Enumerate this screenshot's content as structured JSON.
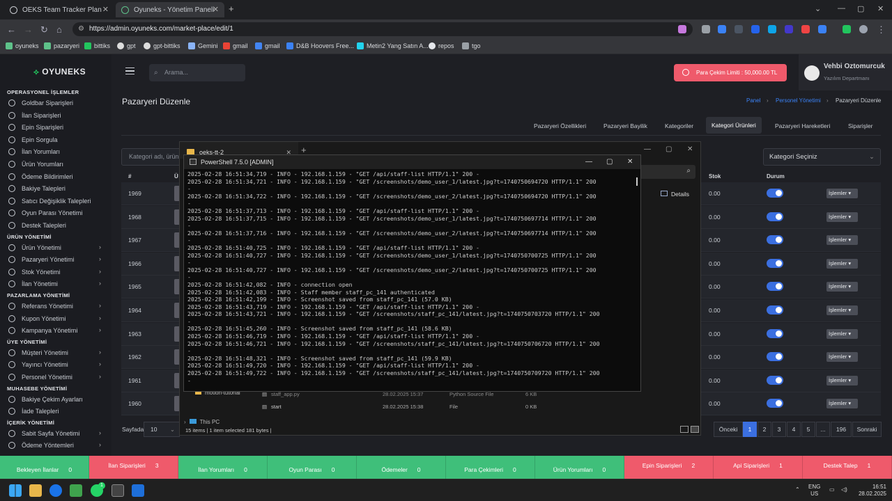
{
  "browser": {
    "tabs": [
      {
        "label": "OEKS Team Tracker Plan"
      },
      {
        "label": "Oyuneks - Yönetim Paneli"
      }
    ],
    "url": "https://admin.oyuneks.com/market-place/edit/1",
    "bookmarks": [
      "oyuneks",
      "pazaryeri",
      "bittiks",
      "gpt",
      "gpt-bittiks",
      "Gemini",
      "gmail",
      "gmail",
      "D&B Hoovers Free...",
      "Metin2 Yang Satın A...",
      "repos",
      "tgo"
    ]
  },
  "brand": "OYUNEKS",
  "sidebar": {
    "sections": [
      {
        "title": "OPERASYONEL İŞLEMLER",
        "items": [
          "Goldbar Siparişleri",
          "İlan Siparişleri",
          "Epin Siparişleri",
          "Epin Sorgula",
          "İlan Yorumları",
          "Ürün Yorumları",
          "Ödeme Bildirimleri",
          "Bakiye Talepleri",
          "Satıcı Değişiklik Talepleri",
          "Oyun Parası Yönetimi",
          "Destek Talepleri"
        ]
      },
      {
        "title": "ÜRÜN YÖNETİMİ",
        "items": [
          "Ürün Yönetimi",
          "Pazaryeri Yönetimi",
          "Stok Yönetimi",
          "İlan Yönetimi"
        ]
      },
      {
        "title": "PAZARLAMA YÖNETİMİ",
        "items": [
          "Referans Yönetimi",
          "Kupon Yönetimi",
          "Kampanya Yönetimi"
        ]
      },
      {
        "title": "ÜYE YÖNETİMİ",
        "items": [
          "Müşteri Yönetimi",
          "Yayıncı Yönetimi",
          "Personel Yönetimi"
        ]
      },
      {
        "title": "MUHASEBE YÖNETİMİ",
        "items": [
          "Bakiye Çekim Ayarları",
          "İade Talepleri"
        ]
      },
      {
        "title": "İÇERİK YÖNETİMİ",
        "items": [
          "Sabit Sayfa Yönetimi",
          "Ödeme Yöntemleri"
        ]
      }
    ]
  },
  "header": {
    "search_placeholder": "Arama...",
    "limit_text": "Para Çekim Limiti : 50,000.00 TL",
    "user_name": "Vehbi Oztomurcuk",
    "user_dept": "Yazılım Departmanı"
  },
  "page": {
    "title": "Pazaryeri Düzenle",
    "breadcrumb": [
      "Panel",
      "Personel Yönetimi",
      "Pazaryeri Düzenle"
    ],
    "tabs": [
      "Pazaryeri Özellikleri",
      "Pazaryeri Bayilik",
      "Kategoriler",
      "Kategori Ürünleri",
      "Pazaryeri Hareketleri",
      "Siparişler"
    ],
    "filter_placeholder": "Kategori adı, ürün",
    "category_select": "Kategori Seçiniz",
    "columns": {
      "id": "#",
      "product": "Ü",
      "stock": "Stok",
      "status": "Durum"
    },
    "rows": [
      {
        "id": "1969",
        "stock": "0.00"
      },
      {
        "id": "1968",
        "stock": "0.00"
      },
      {
        "id": "1967",
        "stock": "0.00"
      },
      {
        "id": "1966",
        "stock": "0.00"
      },
      {
        "id": "1965",
        "stock": "0.00"
      },
      {
        "id": "1964",
        "stock": "0.00"
      },
      {
        "id": "1963",
        "stock": "0.00"
      },
      {
        "id": "1962",
        "stock": "0.00"
      },
      {
        "id": "1961",
        "stock": "0.00"
      },
      {
        "id": "1960",
        "stock": "0.00"
      }
    ],
    "ops_label": "İşlemler",
    "per_page_label": "Sayfada",
    "per_page": "10",
    "pagination": [
      "Önceki",
      "1",
      "2",
      "3",
      "4",
      "5",
      "...",
      "196",
      "Sonraki"
    ]
  },
  "explorer": {
    "tab": "oeks-tt-2",
    "details": "Details",
    "side": [
      "motion-tutorial",
      "This PC"
    ],
    "files": [
      {
        "name": "staff_app.py",
        "date": "28.02.2025 15:37",
        "type": "Python Source File",
        "size": "6 KB"
      },
      {
        "name": "start",
        "date": "28.02.2025 15:38",
        "type": "File",
        "size": "0 KB"
      }
    ],
    "status": "15 items  |  1 item selected  181 bytes  |"
  },
  "powershell": {
    "title": "PowerShell 7.5.0 [ADMIN]",
    "lines": [
      "2025-02-28 16:51:34,719 - INFO - 192.168.1.159 - \"GET /api/staff-list HTTP/1.1\" 200 -",
      "2025-02-28 16:51:34,721 - INFO - 192.168.1.159 - \"GET /screenshots/demo_user_1/latest.jpg?t=1740750694720 HTTP/1.1\" 200",
      "-",
      "2025-02-28 16:51:34,722 - INFO - 192.168.1.159 - \"GET /screenshots/demo_user_2/latest.jpg?t=1740750694720 HTTP/1.1\" 200",
      "-",
      "2025-02-28 16:51:37,713 - INFO - 192.168.1.159 - \"GET /api/staff-list HTTP/1.1\" 200 -",
      "2025-02-28 16:51:37,715 - INFO - 192.168.1.159 - \"GET /screenshots/demo_user_1/latest.jpg?t=1740750697714 HTTP/1.1\" 200",
      "-",
      "2025-02-28 16:51:37,716 - INFO - 192.168.1.159 - \"GET /screenshots/demo_user_2/latest.jpg?t=1740750697714 HTTP/1.1\" 200",
      "-",
      "2025-02-28 16:51:40,725 - INFO - 192.168.1.159 - \"GET /api/staff-list HTTP/1.1\" 200 -",
      "2025-02-28 16:51:40,727 - INFO - 192.168.1.159 - \"GET /screenshots/demo_user_1/latest.jpg?t=1740750700725 HTTP/1.1\" 200",
      "-",
      "2025-02-28 16:51:40,727 - INFO - 192.168.1.159 - \"GET /screenshots/demo_user_2/latest.jpg?t=1740750700725 HTTP/1.1\" 200",
      "-",
      "2025-02-28 16:51:42,082 - INFO - connection open",
      "2025-02-28 16:51:42,083 - INFO - Staff member staff_pc_141 authenticated",
      "2025-02-28 16:51:42,199 - INFO - Screenshot saved from staff_pc_141 (57.0 KB)",
      "2025-02-28 16:51:43,719 - INFO - 192.168.1.159 - \"GET /api/staff-list HTTP/1.1\" 200 -",
      "2025-02-28 16:51:43,721 - INFO - 192.168.1.159 - \"GET /screenshots/staff_pc_141/latest.jpg?t=1740750703720 HTTP/1.1\" 200",
      "-",
      "2025-02-28 16:51:45,260 - INFO - Screenshot saved from staff_pc_141 (58.6 KB)",
      "2025-02-28 16:51:46,719 - INFO - 192.168.1.159 - \"GET /api/staff-list HTTP/1.1\" 200 -",
      "2025-02-28 16:51:46,721 - INFO - 192.168.1.159 - \"GET /screenshots/staff_pc_141/latest.jpg?t=1740750706720 HTTP/1.1\" 200",
      "-",
      "2025-02-28 16:51:48,321 - INFO - Screenshot saved from staff_pc_141 (59.9 KB)",
      "2025-02-28 16:51:49,720 - INFO - 192.168.1.159 - \"GET /api/staff-list HTTP/1.1\" 200 -",
      "2025-02-28 16:51:49,722 - INFO - 192.168.1.159 - \"GET /screenshots/staff_pc_141/latest.jpg?t=1740750709720 HTTP/1.1\" 200",
      "-"
    ]
  },
  "statusbar": [
    {
      "label": "Bekleyen İlanlar",
      "count": "0",
      "color": "green"
    },
    {
      "label": "İlan Siparişleri",
      "count": "3",
      "color": "red"
    },
    {
      "label": "İlan Yorumları",
      "count": "0",
      "color": "green"
    },
    {
      "label": "Oyun Parası",
      "count": "0",
      "color": "green"
    },
    {
      "label": "Ödemeler",
      "count": "0",
      "color": "green"
    },
    {
      "label": "Para Çekimleri",
      "count": "0",
      "color": "green"
    },
    {
      "label": "Ürün Yorumları",
      "count": "0",
      "color": "green"
    },
    {
      "label": "Epin Siparişleri",
      "count": "2",
      "color": "red"
    },
    {
      "label": "Api Siparişleri",
      "count": "1",
      "color": "red"
    },
    {
      "label": "Destek Talep",
      "count": "1",
      "color": "red"
    }
  ],
  "taskbar": {
    "lang": "ENG",
    "region": "US",
    "time": "16:51",
    "date": "28.02.2025",
    "badge": "1"
  }
}
